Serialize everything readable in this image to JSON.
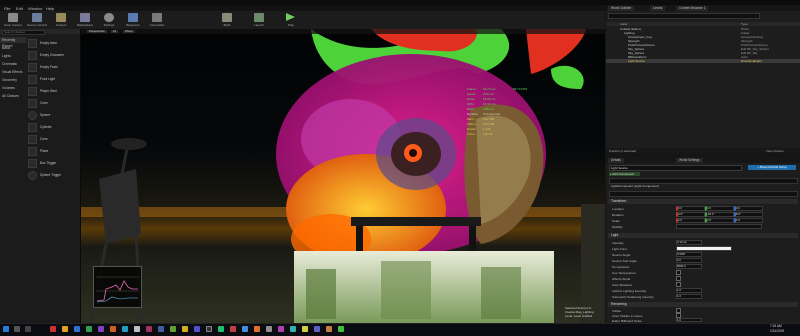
{
  "menu": [
    "File",
    "Edit",
    "Window",
    "Help"
  ],
  "toolbar": [
    "Save Current",
    "Source Control",
    "Content",
    "Marketplace",
    "Settings",
    "Blueprints",
    "Cinematics",
    "Build",
    "Launch",
    "Play"
  ],
  "modes": {
    "search_placeholder": "Search Classes",
    "categories": [
      "Recently Placed",
      "Basic",
      "Lights",
      "Cinematic",
      "Visual Effects",
      "Geometry",
      "Volumes",
      "All Classes"
    ],
    "placeables": [
      "Empty Actor",
      "Empty Character",
      "Empty Pawn",
      "Point Light",
      "Player Start",
      "Cube",
      "Sphere",
      "Cylinder",
      "Cone",
      "Plane",
      "Box Trigger",
      "Sphere Trigger"
    ]
  },
  "viewport": {
    "buttons": [
      "Perspective",
      "Lit",
      "Show"
    ],
    "stats": [
      {
        "k": "Frame:",
        "v": "16.74 ms",
        "c": "#59e05a"
      },
      {
        "k": "Game:",
        "v": "2.61 ms",
        "c": "#59e05a"
      },
      {
        "k": "Draw:",
        "v": "16.60 ms",
        "c": "#59e05a"
      },
      {
        "k": "GPU:",
        "v": "16.31 ms",
        "c": "#59e05a"
      },
      {
        "k": "RHIT:",
        "v": "2.85 ms",
        "c": "#59e05a"
      },
      {
        "k": "DynRes:",
        "v": "Unsupported",
        "c": "#d0d0d0"
      },
      {
        "k": "Mem:",
        "v": "2.37 GB",
        "c": "#d8d060"
      },
      {
        "k": "VMem:",
        "v": "5.22 GB",
        "c": "#d8d060"
      },
      {
        "k": "Draws:",
        "v": "1,126",
        "c": "#d8d060"
      },
      {
        "k": "Prims:",
        "v": "3.01 M",
        "c": "#d8d060"
      }
    ],
    "fps": "59.74 FPS",
    "note_lines": [
      "Selected Actor(s) In:",
      "Inverse Map_Lighting",
      "Level: Level Untitled"
    ]
  },
  "outliner": {
    "tabs": [
      "World Outliner",
      "Levels",
      "Content Browser 1"
    ],
    "columns": [
      "Label",
      "Type"
    ],
    "rows": [
      {
        "name": "Untitled (Editor)",
        "type": "World"
      },
      {
        "name": "Lighting",
        "type": "Folder"
      },
      {
        "name": "Atmospheric_Fog",
        "type": "AtmosphericFog"
      },
      {
        "name": "SkyLight",
        "type": "SkyLight"
      },
      {
        "name": "PostProcessVolume",
        "type": "PostProcessVolume"
      },
      {
        "name": "Sky_Sphere",
        "type": "Edit BP_Sky_Sphere"
      },
      {
        "name": "Sky_Sphere",
        "type": "Edit BP_Sky"
      },
      {
        "name": "BillboardActor",
        "type": "Actor"
      },
      {
        "name": "Light Source",
        "type": "DirectionalLight"
      }
    ],
    "footer": "8 actors (1 selected)",
    "view_options": "View Options"
  },
  "details": {
    "tabs": [
      "Details",
      "World Settings"
    ],
    "selected_name": "Light Source",
    "search_placeholder": "Search Details",
    "component": "LightComponent (Light Component)",
    "sections": {
      "transform": "Transform",
      "light": "Light",
      "rendering": "Rendering"
    },
    "transform_props": [
      {
        "label": "Location",
        "x": "0.0",
        "y": "0.0",
        "z": "0.0"
      },
      {
        "label": "Rotation",
        "x": "0.0°",
        "y": "-46.1°",
        "z": "8.0°"
      },
      {
        "label": "Scale",
        "x": "2.5",
        "y": "2.5",
        "z": "2.5"
      },
      {
        "label": "Mobility",
        "x": "",
        "y": "",
        "z": ""
      }
    ],
    "light_props": [
      "Intensity",
      "Light Color",
      "Source Angle",
      "Source Soft Angle",
      "Temperature",
      "Use Temperature",
      "Affects World",
      "Cast Shadows",
      "Indirect Lighting Intensity",
      "Volumetric Scattering Intensity"
    ],
    "light_values": [
      "3.14 lux",
      "",
      "0.5357",
      "0.0",
      "6500.0",
      "",
      "",
      "",
      "1.0",
      "1.0"
    ],
    "render_props": [
      "Visible",
      "Actor Hidden In Game",
      "Editor Billboard Scale"
    ],
    "render_values": [
      "",
      "",
      "1.0"
    ]
  },
  "taskbar": {
    "time": "7:15 AM",
    "date": "1/31/2019"
  }
}
